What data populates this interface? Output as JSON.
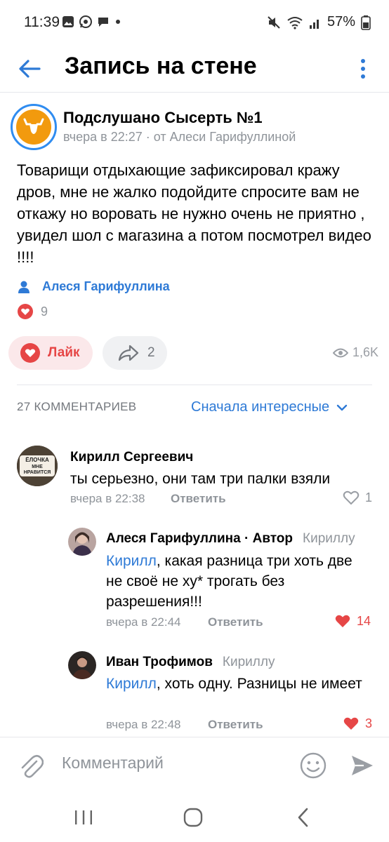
{
  "status_bar": {
    "time": "11:39",
    "battery": "57%"
  },
  "header": {
    "title": "Запись на стене"
  },
  "post": {
    "group_name": "Подслушано Сысерть №1",
    "meta": "вчера в 22:27 · от Алеси Гарифуллиной",
    "text": "Товарищи отдыхающие зафиксировал кражу дров, мне не жалко подойдите спросите вам не откажу но воровать не нужно очень не приятно , увидел шол с магазина а потом посмотрел видео !!!!",
    "signer": "Алеся Гарифуллина",
    "reactions_count": "9",
    "like_label": "Лайк",
    "share_count": "2",
    "views": "1,6K"
  },
  "comments_header": {
    "count_label": "27 КОММЕНТАРИЕВ",
    "sort_label": "Сначала интересные"
  },
  "comments": [
    {
      "avatar_text_top": "ЁЛОЧКА",
      "avatar_text_bottom": "МНЕ НРАВИТСЯ",
      "name": "Кирилл Сергеевич",
      "text": "ты серьезно, они там три палки взяли",
      "time": "вчера в 22:38",
      "reply_label": "Ответить",
      "likes": "1"
    },
    {
      "name": "Алеся Гарифуллина · Автор",
      "reply_to": "Кириллу",
      "mention": "Кирилл",
      "text": ", какая разница три хоть две не своё не ху* трогать без разрешения!!!",
      "time": "вчера в 22:44",
      "reply_label": "Ответить",
      "likes": "14"
    },
    {
      "name": "Иван Трофимов",
      "reply_to": "Кириллу",
      "mention": "Кирилл",
      "text": ", хоть одну. Разницы не имеет",
      "time": "вчера в 22:48",
      "reply_label": "Ответить",
      "likes": "3"
    }
  ],
  "input": {
    "placeholder": "Комментарий"
  },
  "colors": {
    "accent": "#2e7ad6",
    "like_red": "#e64646",
    "secondary_text": "#8f949a"
  }
}
